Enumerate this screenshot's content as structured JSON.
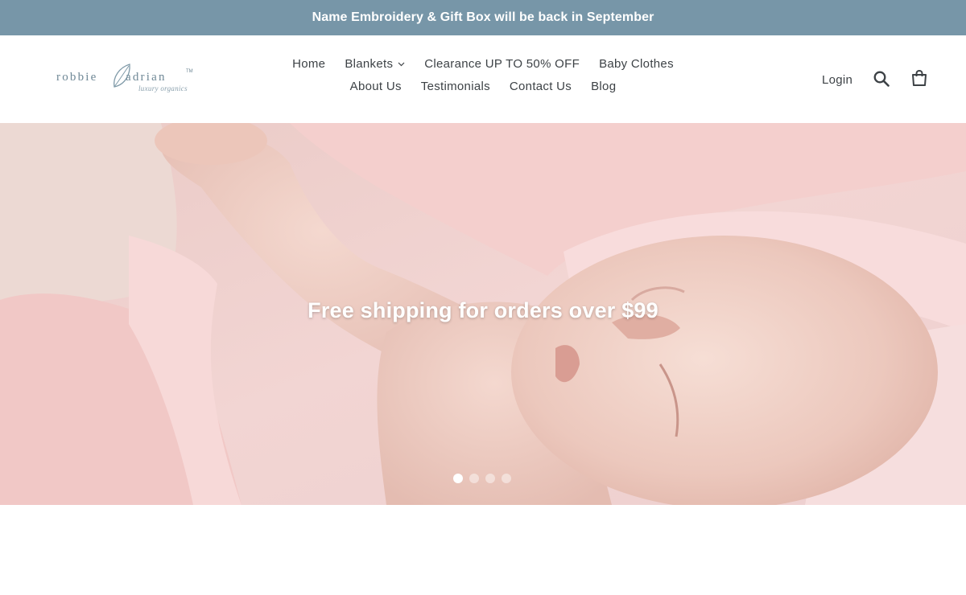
{
  "announcement": {
    "text": "Name Embroidery & Gift Box will be back in September"
  },
  "logo": {
    "word_left": "robbie",
    "word_right": "adrian",
    "trademark": "TM",
    "tagline": "luxury organics"
  },
  "nav": {
    "row1": [
      {
        "label": "Home"
      },
      {
        "label": "Blankets",
        "dropdown": true
      },
      {
        "label": "Clearance UP TO 50% OFF"
      },
      {
        "label": "Baby Clothes"
      }
    ],
    "row2": [
      {
        "label": "About Us"
      },
      {
        "label": "Testimonials"
      },
      {
        "label": "Contact Us"
      },
      {
        "label": "Blog"
      }
    ]
  },
  "header_actions": {
    "login_label": "Login",
    "search_icon": "search-icon",
    "cart_icon": "cart-icon"
  },
  "hero": {
    "caption": "Free shipping for orders over $99",
    "slide_count": 4,
    "active_slide": 1
  },
  "colors": {
    "announcement_bg": "#7796a8",
    "text": "#3d4246",
    "logo": "#6f8896"
  }
}
